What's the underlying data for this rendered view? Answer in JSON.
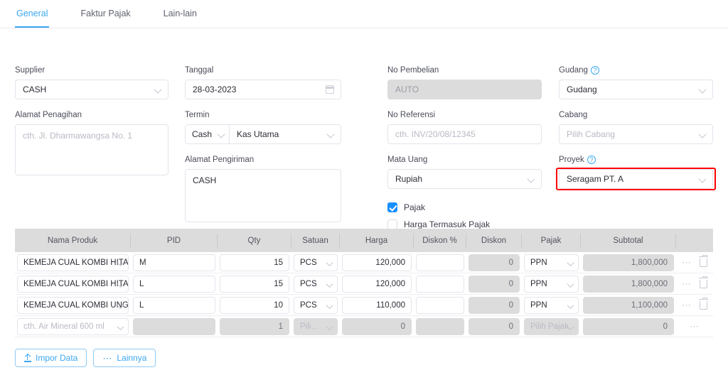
{
  "tabs": [
    {
      "label": "General",
      "active": true
    },
    {
      "label": "Faktur Pajak",
      "active": false
    },
    {
      "label": "Lain-lain",
      "active": false
    }
  ],
  "form": {
    "supplier": {
      "label": "Supplier",
      "value": "CASH"
    },
    "tanggal": {
      "label": "Tanggal",
      "value": "28-03-2023"
    },
    "no_pembelian": {
      "label": "No Pembelian",
      "value": "AUTO"
    },
    "gudang": {
      "label": "Gudang",
      "value": "Gudang",
      "help": "?"
    },
    "alamat_penagihan": {
      "label": "Alamat Penagihan",
      "placeholder": "cth. Jl. Dharmawangsa No. 1",
      "value": ""
    },
    "termin": {
      "label": "Termin",
      "type_value": "Cash",
      "account_value": "Kas Utama"
    },
    "no_referensi": {
      "label": "No Referensi",
      "placeholder": "cth. INV/20/08/12345",
      "value": ""
    },
    "cabang": {
      "label": "Cabang",
      "placeholder": "Pilih Cabang",
      "value": ""
    },
    "alamat_pengiriman": {
      "label": "Alamat Pengiriman",
      "value": "CASH"
    },
    "mata_uang": {
      "label": "Mata Uang",
      "value": "Rupiah"
    },
    "proyek": {
      "label": "Proyek",
      "value": "Seragam PT. A",
      "help": "?",
      "highlight_color": "#ff0000"
    },
    "pajak_checkbox": {
      "label": "Pajak",
      "checked": true
    },
    "harga_termasuk_pajak_checkbox": {
      "label": "Harga Termasuk Pajak",
      "checked": false
    }
  },
  "table": {
    "columns": [
      "Nama Produk",
      "PID",
      "Qty",
      "Satuan",
      "Harga",
      "Diskon %",
      "Diskon",
      "Pajak",
      "Subtotal",
      ""
    ],
    "rows": [
      {
        "nama_produk": "KEMEJA CUAL KOMBI HITAM",
        "pid": "M",
        "qty": "15",
        "satuan": "PCS",
        "harga": "120,000",
        "diskon_persen": "",
        "diskon": "0",
        "pajak": "PPN",
        "subtotal": "1,800,000",
        "has_delete": true,
        "empty": false
      },
      {
        "nama_produk": "KEMEJA CUAL KOMBI HITAM",
        "pid": "L",
        "qty": "15",
        "satuan": "PCS",
        "harga": "120,000",
        "diskon_persen": "",
        "diskon": "0",
        "pajak": "PPN",
        "subtotal": "1,800,000",
        "has_delete": true,
        "empty": false
      },
      {
        "nama_produk": "KEMEJA CUAL KOMBI UNGU",
        "pid": "L",
        "qty": "10",
        "satuan": "PCS",
        "harga": "110,000",
        "diskon_persen": "",
        "diskon": "0",
        "pajak": "PPN",
        "subtotal": "1,100,000",
        "has_delete": true,
        "empty": false
      },
      {
        "nama_produk": "cth. Air Mineral 600 ml",
        "pid": "",
        "qty": "1",
        "satuan": "Pili...",
        "harga": "0",
        "diskon_persen": "",
        "diskon": "0",
        "pajak": "Pilih Pajak",
        "subtotal": "0",
        "has_delete": false,
        "empty": true
      }
    ]
  },
  "footer": {
    "impor_data": "Impor Data",
    "lainnya": "Lainnya",
    "lainnya_icon": "ellipsis-icon",
    "impor_icon": "upload-icon"
  }
}
